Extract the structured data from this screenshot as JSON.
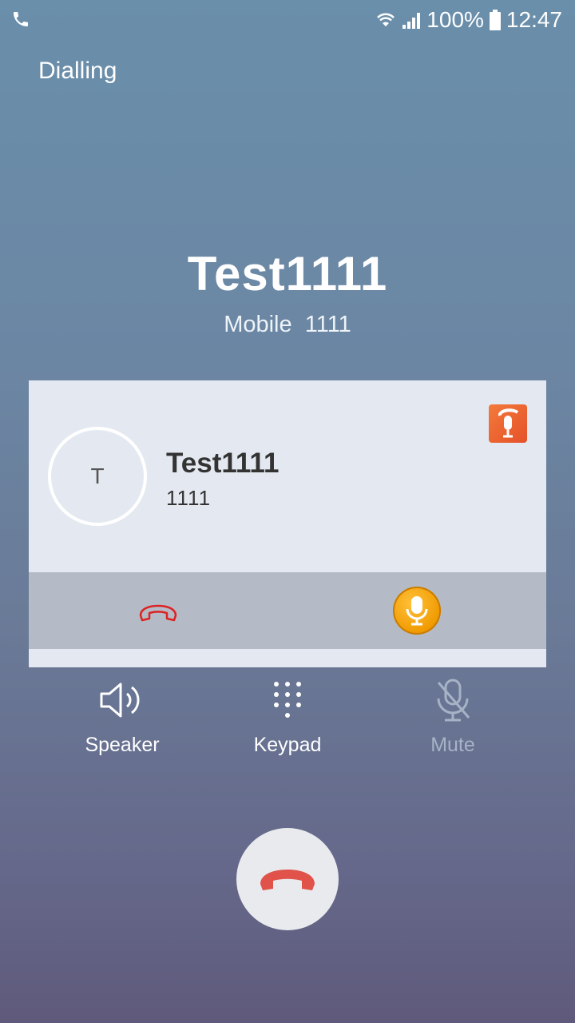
{
  "status_bar": {
    "battery": "100%",
    "time": "12:47"
  },
  "call": {
    "state": "Dialling",
    "name": "Test1111",
    "label": "Mobile",
    "number": "1111"
  },
  "card": {
    "avatar_letter": "T",
    "name": "Test1111",
    "number": "1111"
  },
  "controls": {
    "speaker": "Speaker",
    "keypad": "Keypad",
    "mute": "Mute"
  },
  "colors": {
    "hangup_red": "#e0524a",
    "mic_orange": "#f09a00"
  }
}
